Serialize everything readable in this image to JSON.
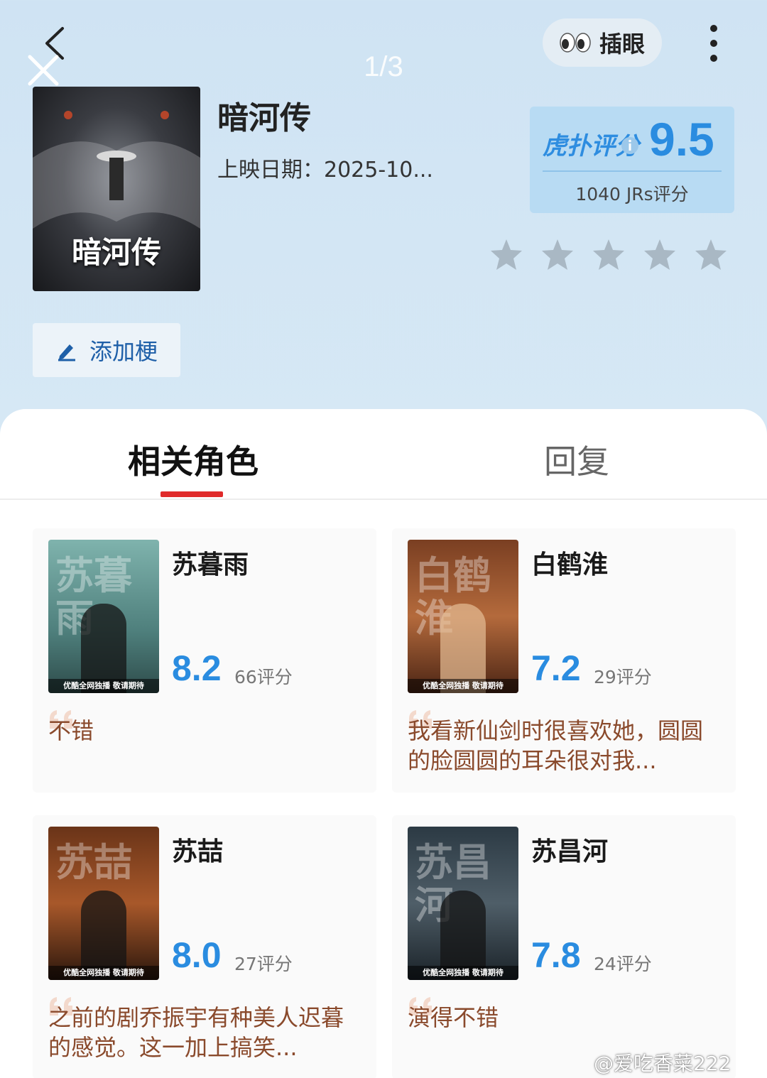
{
  "nav": {
    "page_counter": "1/3",
    "peek_label": "插眼"
  },
  "drama": {
    "title": "暗河传",
    "release_date": "上映日期：2025-10...",
    "poster_title": "暗河传"
  },
  "score": {
    "logo": "虎扑评分",
    "value": "9.5",
    "count_label": "1040 JRs评分",
    "accent_color": "#2a8ce0",
    "stars_rating": 0
  },
  "actions": {
    "add_meme": "添加梗"
  },
  "tabs": [
    {
      "label": "相关角色",
      "active": true
    },
    {
      "label": "回复",
      "active": false
    }
  ],
  "roles": [
    {
      "name": "苏暮雨",
      "score": "8.2",
      "count": "66评分",
      "comment": "不错",
      "poster_chars": "苏暮雨",
      "poster_tag": "优酷全网独播 敬请期待"
    },
    {
      "name": "白鹤淮",
      "score": "7.2",
      "count": "29评分",
      "comment": "我看新仙剑时很喜欢她，圆圆的脸圆圆的耳朵很对我...",
      "poster_chars": "白鹤淮",
      "poster_tag": "优酷全网独播 敬请期待"
    },
    {
      "name": "苏喆",
      "score": "8.0",
      "count": "27评分",
      "comment": "之前的剧乔振宇有种美人迟暮的感觉。这一加上搞笑...",
      "poster_chars": "苏喆",
      "poster_tag": "优酷全网独播 敬请期待"
    },
    {
      "name": "苏昌河",
      "score": "7.8",
      "count": "24评分",
      "comment": "演得不错",
      "poster_chars": "苏昌河",
      "poster_tag": "优酷全网独播 敬请期待"
    }
  ],
  "watermark": "@爱吃香菜222"
}
